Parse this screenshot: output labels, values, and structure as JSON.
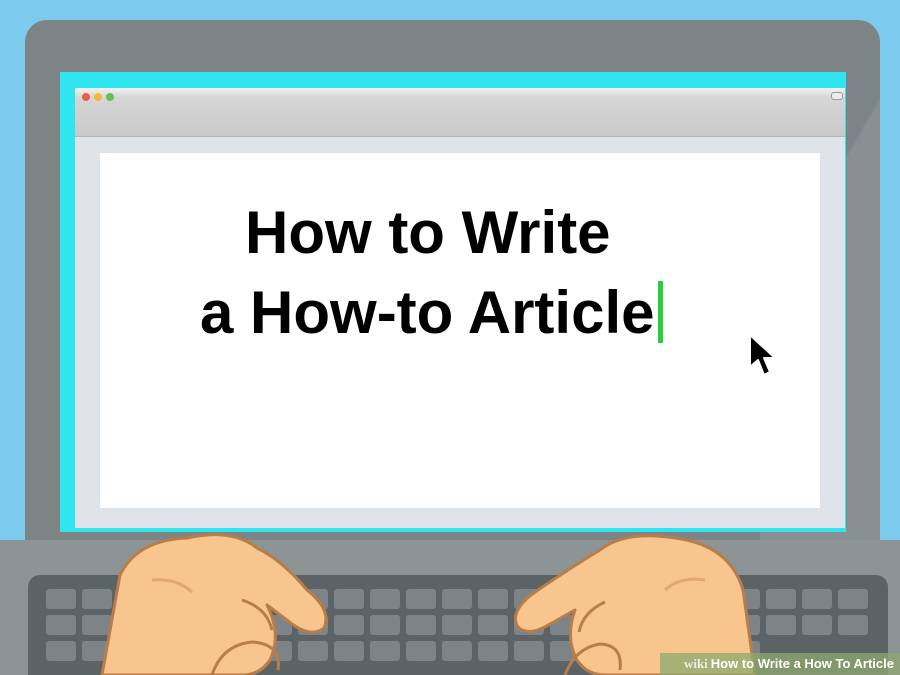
{
  "scene": {
    "background_color": "#7ccbee",
    "screen_bezel_color": "#2fe6f0",
    "caret_color": "#23d13f"
  },
  "window": {
    "controls": {
      "close_icon": "close-dot-icon",
      "minimize_icon": "minimize-dot-icon",
      "zoom_icon": "zoom-dot-icon"
    }
  },
  "document": {
    "title_line1": "How to Write",
    "title_line2": "a How-to Article"
  },
  "icons": {
    "pointer": "mouse-pointer-icon",
    "caret": "text-caret-icon"
  },
  "watermark": {
    "brand": "wiki",
    "text": "How to Write a How To Article"
  }
}
